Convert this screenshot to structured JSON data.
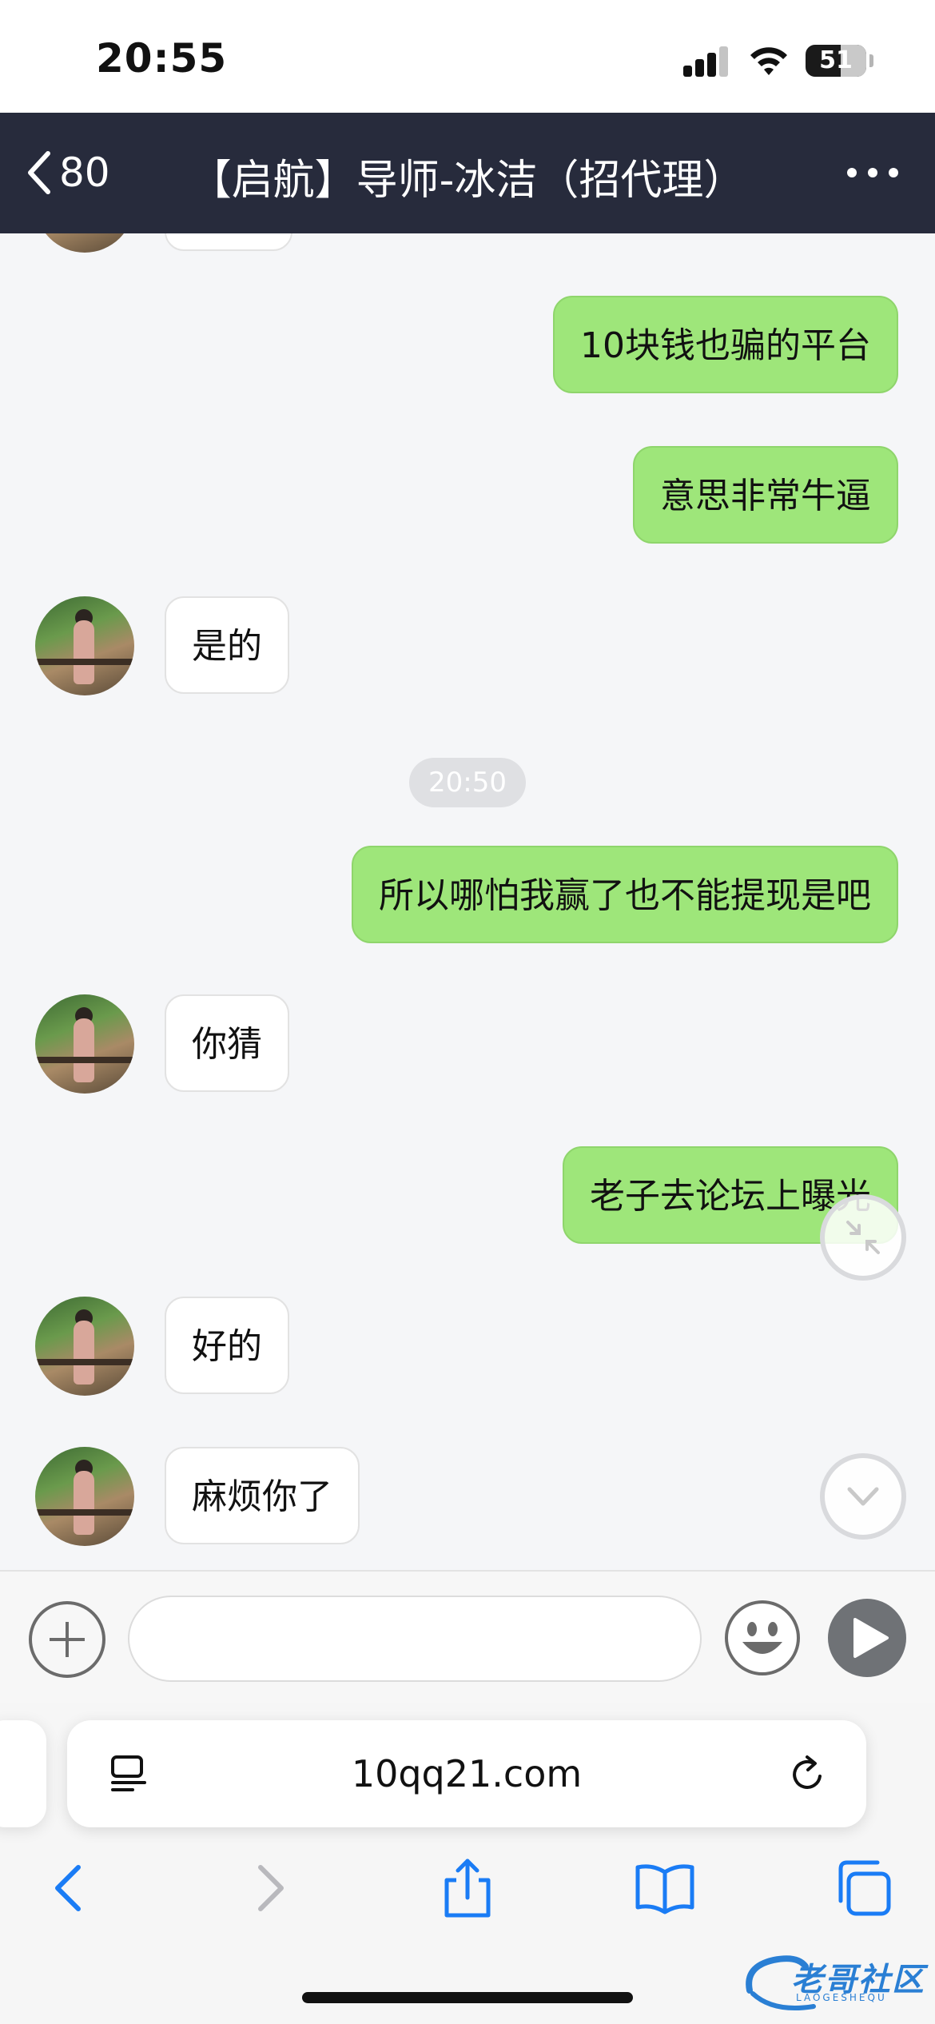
{
  "status_bar": {
    "time": "20:55",
    "battery_level": "51"
  },
  "nav": {
    "back_count": "80",
    "title": "【启航】导师-冰洁（招代理）"
  },
  "chat": {
    "messages": [
      {
        "direction": "out",
        "text": "10块钱也骗的平台"
      },
      {
        "direction": "out",
        "text": "意思非常牛逼"
      },
      {
        "direction": "in",
        "text": "是的"
      },
      {
        "type": "timestamp",
        "text": "20:50"
      },
      {
        "direction": "out",
        "text": "所以哪怕我赢了也不能提现是吧"
      },
      {
        "direction": "in",
        "text": "你猜"
      },
      {
        "direction": "out",
        "text": "老子去论坛上曝光"
      },
      {
        "direction": "in",
        "text": "好的"
      },
      {
        "direction": "in",
        "text": "麻烦你了"
      }
    ]
  },
  "input": {
    "value": "",
    "placeholder": ""
  },
  "safari": {
    "url": "10qq21.com"
  },
  "watermark": {
    "text": "老哥社区",
    "sub": "LAOGESHEQU"
  },
  "colors": {
    "nav_bg": "#272b3c",
    "outgoing_bubble": "#9ee67a",
    "incoming_bubble": "#ffffff",
    "chat_bg": "#f5f6f8",
    "safari_accent": "#1a7cf5"
  }
}
